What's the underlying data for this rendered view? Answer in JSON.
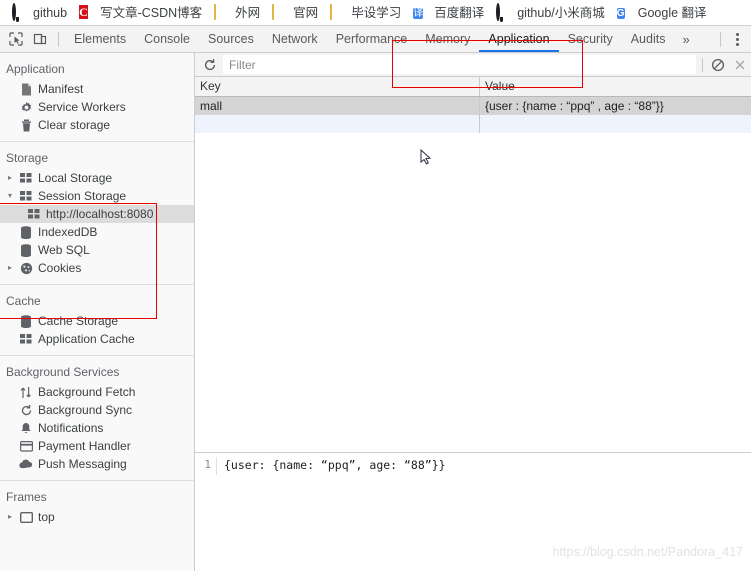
{
  "bookmarks": [
    {
      "icon": "github-icon",
      "label": "github"
    },
    {
      "icon": "csdn-icon",
      "label": "写文章-CSDN博客"
    },
    {
      "icon": "folder-icon",
      "label": "外网"
    },
    {
      "icon": "folder-icon",
      "label": "官网"
    },
    {
      "icon": "folder-icon",
      "label": "毕设学习"
    },
    {
      "icon": "baidu-fanyi-icon",
      "label": "百度翻译"
    },
    {
      "icon": "github-icon",
      "label": "github/小米商城"
    },
    {
      "icon": "google-translate-icon",
      "label": "Google 翻译"
    }
  ],
  "devtools": {
    "inspect_icon": "inspect-element-icon",
    "device_icon": "device-toolbar-icon",
    "tabs": [
      {
        "label": "Elements",
        "active": false
      },
      {
        "label": "Console",
        "active": false
      },
      {
        "label": "Sources",
        "active": false
      },
      {
        "label": "Network",
        "active": false
      },
      {
        "label": "Performance",
        "active": false
      },
      {
        "label": "Memory",
        "active": false
      },
      {
        "label": "Application",
        "active": true
      },
      {
        "label": "Security",
        "active": false
      },
      {
        "label": "Audits",
        "active": false
      }
    ],
    "more_tabs_label": "»",
    "menu_icon": "kebab-menu-icon"
  },
  "sidebar": {
    "sections": [
      {
        "title": "Application",
        "items": [
          {
            "label": "Manifest",
            "icon": "manifest-icon",
            "twisty": "",
            "indent": false,
            "selected": false
          },
          {
            "label": "Service Workers",
            "icon": "gear-icon",
            "twisty": "",
            "indent": false,
            "selected": false
          },
          {
            "label": "Clear storage",
            "icon": "trash-icon",
            "twisty": "",
            "indent": false,
            "selected": false
          }
        ]
      },
      {
        "title": "Storage",
        "items": [
          {
            "label": "Local Storage",
            "icon": "storage-grid-icon",
            "twisty": "▸",
            "indent": false,
            "selected": false
          },
          {
            "label": "Session Storage",
            "icon": "storage-grid-icon",
            "twisty": "▾",
            "indent": false,
            "selected": false
          },
          {
            "label": "http://localhost:8080",
            "icon": "storage-grid-icon",
            "twisty": "",
            "indent": true,
            "selected": true
          },
          {
            "label": "IndexedDB",
            "icon": "database-icon",
            "twisty": "",
            "indent": false,
            "selected": false
          },
          {
            "label": "Web SQL",
            "icon": "database-icon",
            "twisty": "",
            "indent": false,
            "selected": false
          },
          {
            "label": "Cookies",
            "icon": "cookie-icon",
            "twisty": "▸",
            "indent": false,
            "selected": false
          }
        ]
      },
      {
        "title": "Cache",
        "items": [
          {
            "label": "Cache Storage",
            "icon": "database-icon",
            "twisty": "",
            "indent": false,
            "selected": false
          },
          {
            "label": "Application Cache",
            "icon": "storage-grid-icon",
            "twisty": "",
            "indent": false,
            "selected": false
          }
        ]
      },
      {
        "title": "Background Services",
        "items": [
          {
            "label": "Background Fetch",
            "icon": "updown-arrows-icon",
            "twisty": "",
            "indent": false,
            "selected": false
          },
          {
            "label": "Background Sync",
            "icon": "sync-icon",
            "twisty": "",
            "indent": false,
            "selected": false
          },
          {
            "label": "Notifications",
            "icon": "bell-icon",
            "twisty": "",
            "indent": false,
            "selected": false
          },
          {
            "label": "Payment Handler",
            "icon": "credit-card-icon",
            "twisty": "",
            "indent": false,
            "selected": false
          },
          {
            "label": "Push Messaging",
            "icon": "cloud-icon",
            "twisty": "",
            "indent": false,
            "selected": false
          }
        ]
      },
      {
        "title": "Frames",
        "items": [
          {
            "label": "top",
            "icon": "frame-icon",
            "twisty": "▸",
            "indent": false,
            "selected": false
          }
        ]
      }
    ]
  },
  "filter_bar": {
    "refresh_icon": "refresh-icon",
    "placeholder": "Filter",
    "value": "",
    "clear_all_icon": "clear-all-icon",
    "delete_selected_icon": "delete-selected-icon"
  },
  "table": {
    "columns": [
      "Key",
      "Value"
    ],
    "rows": [
      {
        "key": "mall",
        "value": "{user : {name : “ppq” , age : “88”}}",
        "selected": true
      }
    ]
  },
  "preview": {
    "line_number": "1",
    "content": "{user: {name: “ppq”, age: “88”}}"
  },
  "watermark": "https://blog.csdn.net/Pandora_417",
  "colors": {
    "accent": "#1a73e8",
    "annotation": "#e60000",
    "selection": "#d4d4d4",
    "alt_row": "#eef3fd"
  }
}
